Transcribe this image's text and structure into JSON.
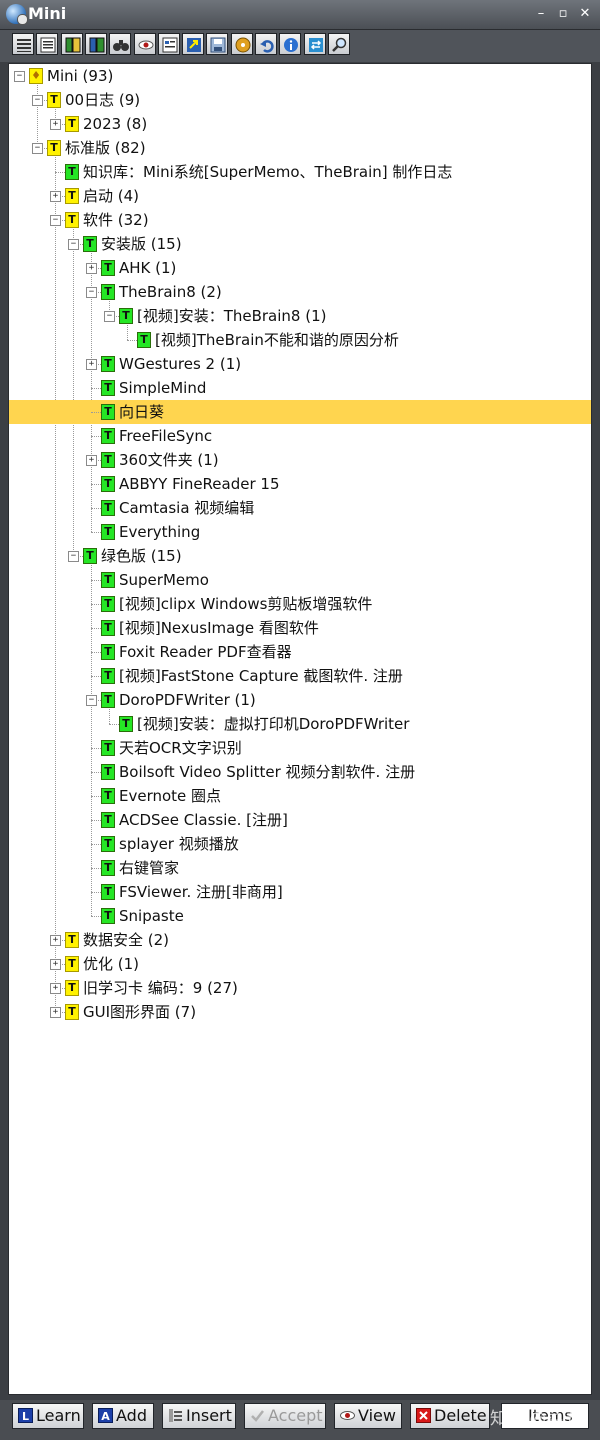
{
  "window": {
    "title": "Mini"
  },
  "titlebar_buttons": [
    {
      "name": "minimize",
      "label": "–"
    },
    {
      "name": "restore",
      "label": "▫"
    },
    {
      "name": "close",
      "label": "✕"
    }
  ],
  "toolbar": {
    "buttons": [
      "list-view-icon",
      "outline-view-icon",
      "book-green-icon",
      "book-blue-icon",
      "binoculars-icon",
      "eye-icon",
      "properties-icon",
      "export-icon",
      "save-icon",
      "disc-icon",
      "undo-icon",
      "info-icon",
      "sync-icon",
      "find-icon"
    ]
  },
  "tree": [
    {
      "level": 0,
      "label": "Mini (93)",
      "icon": "bulb",
      "expander": "minus"
    },
    {
      "level": 1,
      "label": "00日志 (9)",
      "icon": "yellow",
      "expander": "minus"
    },
    {
      "level": 2,
      "label": "2023 (8)",
      "icon": "yellow",
      "expander": "plus"
    },
    {
      "level": 1,
      "label": "标准版 (82)",
      "icon": "yellow",
      "expander": "minus"
    },
    {
      "level": 2,
      "label": "知识库：Mini系统[SuperMemo、TheBrain] 制作日志",
      "icon": "green",
      "expander": "none"
    },
    {
      "level": 2,
      "label": "启动 (4)",
      "icon": "yellow",
      "expander": "plus"
    },
    {
      "level": 2,
      "label": "软件 (32)",
      "icon": "yellow",
      "expander": "minus"
    },
    {
      "level": 3,
      "label": "安装版 (15)",
      "icon": "green",
      "expander": "minus"
    },
    {
      "level": 4,
      "label": "AHK (1)",
      "icon": "green",
      "expander": "plus"
    },
    {
      "level": 4,
      "label": "TheBrain8 (2)",
      "icon": "green",
      "expander": "minus"
    },
    {
      "level": 5,
      "label": "[视频]安装：TheBrain8 (1)",
      "icon": "green",
      "expander": "minus"
    },
    {
      "level": 6,
      "label": "[视频]TheBrain不能和谐的原因分析",
      "icon": "green",
      "expander": "none"
    },
    {
      "level": 4,
      "label": "WGestures 2 (1)",
      "icon": "green",
      "expander": "plus"
    },
    {
      "level": 4,
      "label": "SimpleMind",
      "icon": "green",
      "expander": "none"
    },
    {
      "level": 4,
      "label": "向日葵",
      "icon": "green",
      "expander": "none",
      "selected": true
    },
    {
      "level": 4,
      "label": "FreeFileSync",
      "icon": "green",
      "expander": "none"
    },
    {
      "level": 4,
      "label": "360文件夹 (1)",
      "icon": "green",
      "expander": "plus"
    },
    {
      "level": 4,
      "label": "ABBYY FineReader 15",
      "icon": "green",
      "expander": "none"
    },
    {
      "level": 4,
      "label": "Camtasia 视频编辑",
      "icon": "green",
      "expander": "none"
    },
    {
      "level": 4,
      "label": "Everything",
      "icon": "green",
      "expander": "none"
    },
    {
      "level": 3,
      "label": "绿色版 (15)",
      "icon": "green",
      "expander": "minus"
    },
    {
      "level": 4,
      "label": "SuperMemo",
      "icon": "green",
      "expander": "none"
    },
    {
      "level": 4,
      "label": "[视频]clipx Windows剪贴板增强软件",
      "icon": "green",
      "expander": "none"
    },
    {
      "level": 4,
      "label": "[视频]NexusImage 看图软件",
      "icon": "green",
      "expander": "none"
    },
    {
      "level": 4,
      "label": "Foxit Reader PDF查看器",
      "icon": "green",
      "expander": "none"
    },
    {
      "level": 4,
      "label": "[视频]FastStone Capture 截图软件. 注册",
      "icon": "green",
      "expander": "none"
    },
    {
      "level": 4,
      "label": "DoroPDFWriter (1)",
      "icon": "green",
      "expander": "minus"
    },
    {
      "level": 5,
      "label": "[视频]安装：虚拟打印机DoroPDFWriter",
      "icon": "green",
      "expander": "none"
    },
    {
      "level": 4,
      "label": "天若OCR文字识别",
      "icon": "green",
      "expander": "none"
    },
    {
      "level": 4,
      "label": "Boilsoft Video Splitter 视频分割软件. 注册",
      "icon": "green",
      "expander": "none"
    },
    {
      "level": 4,
      "label": "Evernote 圈点",
      "icon": "green",
      "expander": "none"
    },
    {
      "level": 4,
      "label": "ACDSee Classie. [注册]",
      "icon": "green",
      "expander": "none"
    },
    {
      "level": 4,
      "label": "splayer 视频播放",
      "icon": "green",
      "expander": "none"
    },
    {
      "level": 4,
      "label": "右键管家",
      "icon": "green",
      "expander": "none"
    },
    {
      "level": 4,
      "label": "FSViewer. 注册[非商用]",
      "icon": "green",
      "expander": "none"
    },
    {
      "level": 4,
      "label": "Snipaste",
      "icon": "green",
      "expander": "none"
    },
    {
      "level": 2,
      "label": "数据安全 (2)",
      "icon": "yellow",
      "expander": "plus"
    },
    {
      "level": 2,
      "label": "优化 (1)",
      "icon": "yellow",
      "expander": "plus"
    },
    {
      "level": 2,
      "label": "旧学习卡 编码：9 (27)",
      "icon": "yellow",
      "expander": "plus"
    },
    {
      "level": 2,
      "label": "GUI图形界面 (7)",
      "icon": "yellow",
      "expander": "plus"
    }
  ],
  "node_icon_letter": "T",
  "bottom_buttons": [
    {
      "name": "learn",
      "label": "Learn",
      "icon": "learn-icon",
      "enabled": true
    },
    {
      "name": "add",
      "label": "Add",
      "icon": "add-icon",
      "enabled": true
    },
    {
      "name": "insert",
      "label": "Insert",
      "icon": "insert-icon",
      "enabled": true
    },
    {
      "name": "accept",
      "label": "Accept",
      "icon": "check-icon",
      "enabled": false
    },
    {
      "name": "view",
      "label": "View",
      "icon": "eye-icon",
      "enabled": true
    },
    {
      "name": "delete",
      "label": "Delete",
      "icon": "delete-icon",
      "enabled": true
    }
  ],
  "items_label": "Items",
  "watermark": "知乎 @菜五",
  "colors": {
    "selected_row": "#ffd54f",
    "topic_icon": "#fff200",
    "item_icon": "#25e625"
  }
}
